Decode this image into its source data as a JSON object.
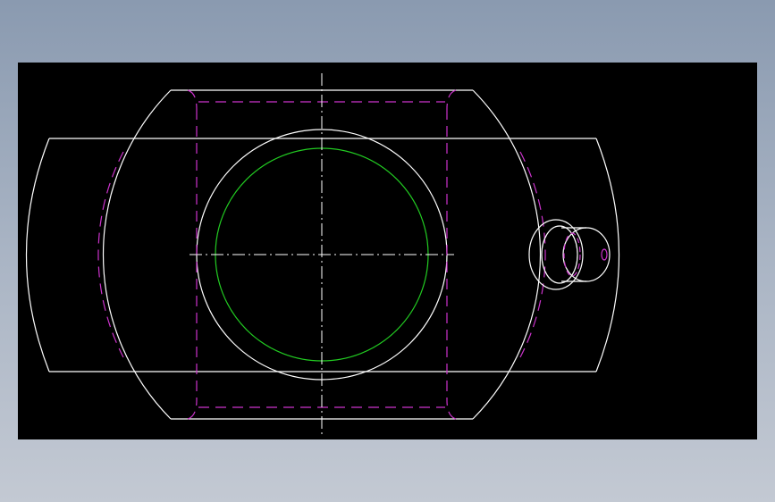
{
  "drawing": {
    "background_color": "#000000",
    "outline_color": "#ffffff",
    "hidden_line_color": "#cc33cc",
    "bore_color": "#22cc22",
    "centerline_color": "#ffffff"
  }
}
